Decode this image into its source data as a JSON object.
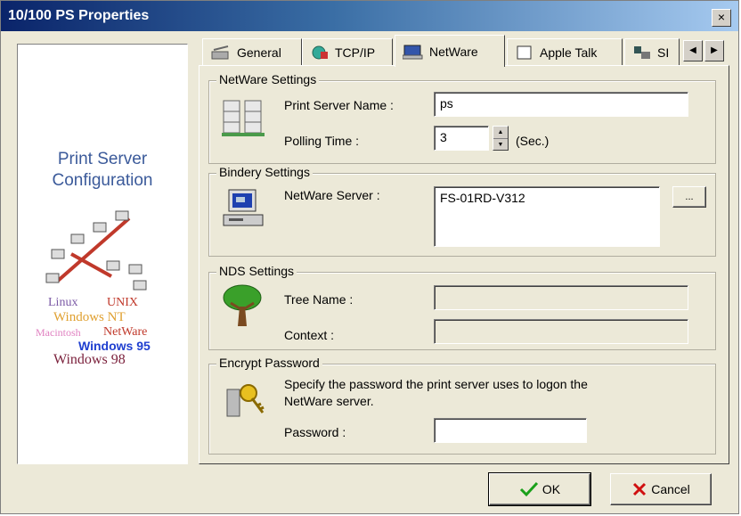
{
  "window": {
    "title": "10/100 PS Properties",
    "close_label": "×"
  },
  "left_panel": {
    "title_line1": "Print Server",
    "title_line2": "Configuration",
    "os_list": [
      {
        "text": "Linux",
        "color": "#7b5aa6"
      },
      {
        "text": "UNIX",
        "color": "#c0392b"
      },
      {
        "text": "Windows NT",
        "color": "#e0a030"
      },
      {
        "text": "Macintosh",
        "color": "#e080c0"
      },
      {
        "text": "NetWare",
        "color": "#c0392b"
      },
      {
        "text": "Windows 95",
        "color": "#1f3fd0"
      },
      {
        "text": "Windows 98",
        "color": "#7a1f3a"
      }
    ]
  },
  "tabs": [
    {
      "label": "General",
      "icon": "general-icon"
    },
    {
      "label": "TCP/IP",
      "icon": "tcpip-icon"
    },
    {
      "label": "NetWare",
      "icon": "netware-icon",
      "active": true
    },
    {
      "label": "Apple Talk",
      "icon": "appletalk-icon"
    },
    {
      "label": "SI",
      "icon": "snmp-icon"
    }
  ],
  "netware_settings": {
    "legend": "NetWare Settings",
    "print_server_name_label": "Print Server Name :",
    "print_server_name_value": "ps",
    "polling_time_label": "Polling Time :",
    "polling_time_value": "3",
    "polling_unit": "(Sec.)"
  },
  "bindery_settings": {
    "legend": "Bindery Settings",
    "server_label": "NetWare Server :",
    "server_value": "FS-01RD-V312",
    "browse_label": "..."
  },
  "nds_settings": {
    "legend": "NDS Settings",
    "tree_name_label": "Tree Name :",
    "tree_name_value": "",
    "context_label": "Context :",
    "context_value": ""
  },
  "encrypt_password": {
    "legend": "Encrypt Password",
    "desc_line1": "Specify the password the print server uses to logon the",
    "desc_line2": "NetWare server.",
    "password_label": "Password :",
    "password_value": ""
  },
  "buttons": {
    "ok": "OK",
    "cancel": "Cancel"
  },
  "colors": {
    "title_bar": "#0a246a",
    "ok_check": "#1aa01a",
    "cancel_x": "#d01010",
    "accent_text": "#3b5a9a"
  }
}
